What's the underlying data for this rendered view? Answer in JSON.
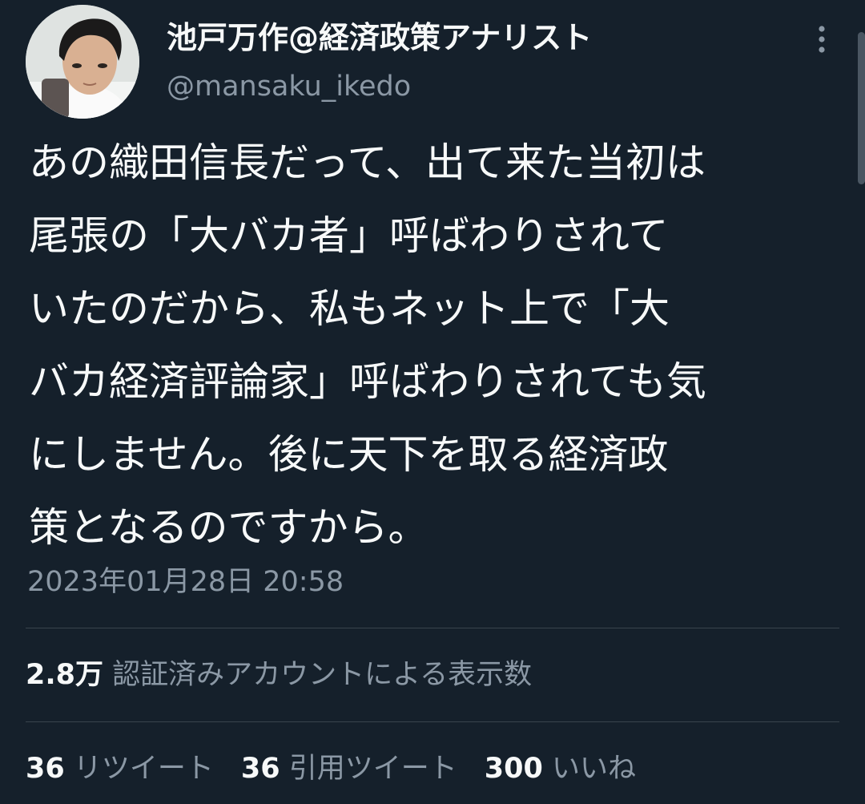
{
  "author": {
    "display_name": "池戸万作@経済政策アナリスト",
    "handle": "@mansaku_ikedo",
    "avatar_icon": "user-avatar-photo"
  },
  "header": {
    "more_icon": "more-vertical-icon"
  },
  "tweet": {
    "lines": [
      "あの織田信長だって、出て来た当初は",
      "尾張の「大バカ者」呼ばわりされて",
      "いたのだから、私もネット上で「大",
      "バカ経済評論家」呼ばわりされても気",
      "にしません。後に天下を取る経済政",
      "策となるのですから。"
    ],
    "timestamp": "2023年01月28日 20:58"
  },
  "views": {
    "count": "2.8万",
    "label": "認証済みアカウントによる表示数"
  },
  "engagement": {
    "retweets": {
      "count": "36",
      "label": "リツイート"
    },
    "quotes": {
      "count": "36",
      "label": "引用ツイート"
    },
    "likes": {
      "count": "300",
      "label": "いいね"
    }
  },
  "colors": {
    "background": "#15202b",
    "primary_text": "#f7f9f9",
    "secondary_text": "#8b98a5",
    "divider": "#38444d"
  }
}
